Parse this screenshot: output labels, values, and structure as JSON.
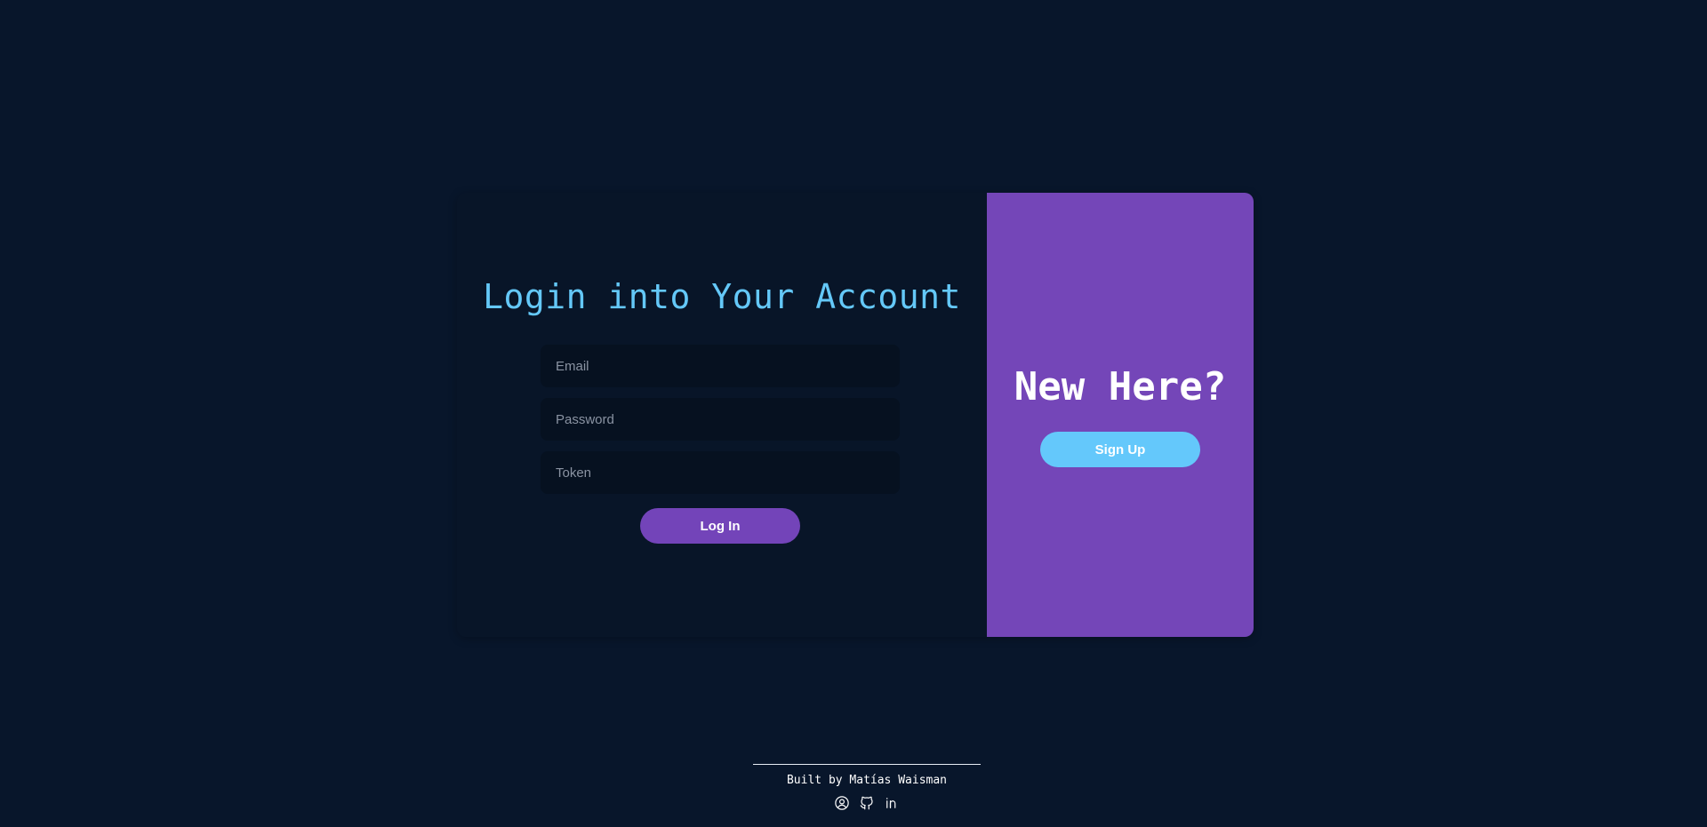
{
  "login": {
    "title": "Login into Your Account",
    "email_placeholder": "Email",
    "password_placeholder": "Password",
    "token_placeholder": "Token",
    "submit_label": "Log In"
  },
  "signup": {
    "title": "New Here?",
    "button_label": "Sign Up"
  },
  "footer": {
    "credit": "Built by Matías Waisman",
    "icons": [
      "user-circle-icon",
      "github-icon",
      "linkedin-icon"
    ]
  },
  "colors": {
    "background": "#08162b",
    "accent_purple": "#7446b8",
    "accent_blue": "#64c8fb",
    "title_blue": "#64c8f8"
  }
}
